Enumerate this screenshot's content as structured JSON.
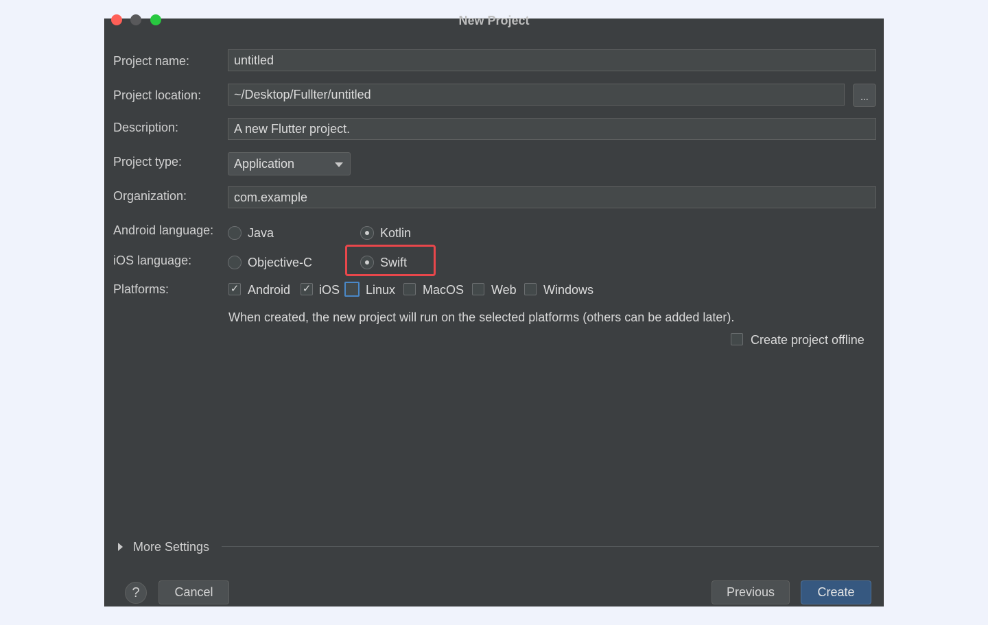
{
  "window": {
    "title": "New Project"
  },
  "form": {
    "project_name": {
      "label": "Project name:",
      "value": "untitled"
    },
    "project_location": {
      "label": "Project location:",
      "value": "~/Desktop/Fullter/untitled",
      "browse_label": "..."
    },
    "description": {
      "label": "Description:",
      "value": "A new Flutter project."
    },
    "project_type": {
      "label": "Project type:",
      "value": "Application"
    },
    "organization": {
      "label": "Organization:",
      "value": "com.example"
    },
    "android_language": {
      "label": "Android language:",
      "options": [
        "Java",
        "Kotlin"
      ],
      "selected": "Kotlin"
    },
    "ios_language": {
      "label": "iOS language:",
      "options": [
        "Objective-C",
        "Swift"
      ],
      "selected": "Swift"
    },
    "platforms": {
      "label": "Platforms:",
      "items": [
        {
          "label": "Android",
          "checked": true
        },
        {
          "label": "iOS",
          "checked": true
        },
        {
          "label": "Linux",
          "checked": false
        },
        {
          "label": "MacOS",
          "checked": false
        },
        {
          "label": "Web",
          "checked": false
        },
        {
          "label": "Windows",
          "checked": false
        }
      ],
      "hint": "When created, the new project will run on the selected platforms (others can be added later)."
    },
    "offline": {
      "label": "Create project offline",
      "checked": false
    }
  },
  "more_settings": {
    "label": "More Settings"
  },
  "footer": {
    "help": "?",
    "cancel": "Cancel",
    "previous": "Previous",
    "create": "Create"
  },
  "colors": {
    "highlight": "#e9474b",
    "primary_button": "#365880",
    "focus": "#4a88c7"
  }
}
